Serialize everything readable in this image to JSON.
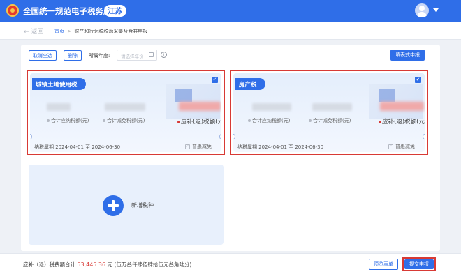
{
  "header": {
    "app_title": "全国统一规范电子税务局",
    "region": "江苏"
  },
  "breadcrumb": {
    "back_label": "← 返回",
    "home": "首页",
    "separator": ">",
    "current": "财产和行为税税源采集及合并申报"
  },
  "toolbar": {
    "cancel_all_label": "取消全选",
    "delete_label": "删除",
    "year_label": "所属年度:",
    "year_placeholder": "请选择年份",
    "fill_form_label": "填表式申报"
  },
  "cards": [
    {
      "title": "城镇土地使用税",
      "checked": true,
      "metric_payable": "合计应纳税额(元)",
      "metric_reduced": "合计减免税额(元)",
      "metric_refund": "应补(退)税额(元)",
      "period": "纳税属期 2024-04-01 至 2024-06-30",
      "preference": "普惠减免"
    },
    {
      "title": "房产税",
      "checked": true,
      "metric_payable": "合计应纳税额(元)",
      "metric_reduced": "合计减免税额(元)",
      "metric_refund": "应补(退)税额(元)",
      "period": "纳税属期 2024-04-01 至 2024-06-30",
      "preference": "普惠减免"
    }
  ],
  "add_tax": {
    "label": "新增税种"
  },
  "footer": {
    "total_label": "应补（退）税费额合计",
    "total_amount": "53,445.36",
    "currency": "元",
    "amount_in_words": "(伍万叁仟肆佰肆拾伍元叁角陆分)",
    "preview_label": "预览表单",
    "submit_label": "提交申报"
  },
  "colors": {
    "primary": "#2f6ee8",
    "highlight": "#d83a35"
  }
}
